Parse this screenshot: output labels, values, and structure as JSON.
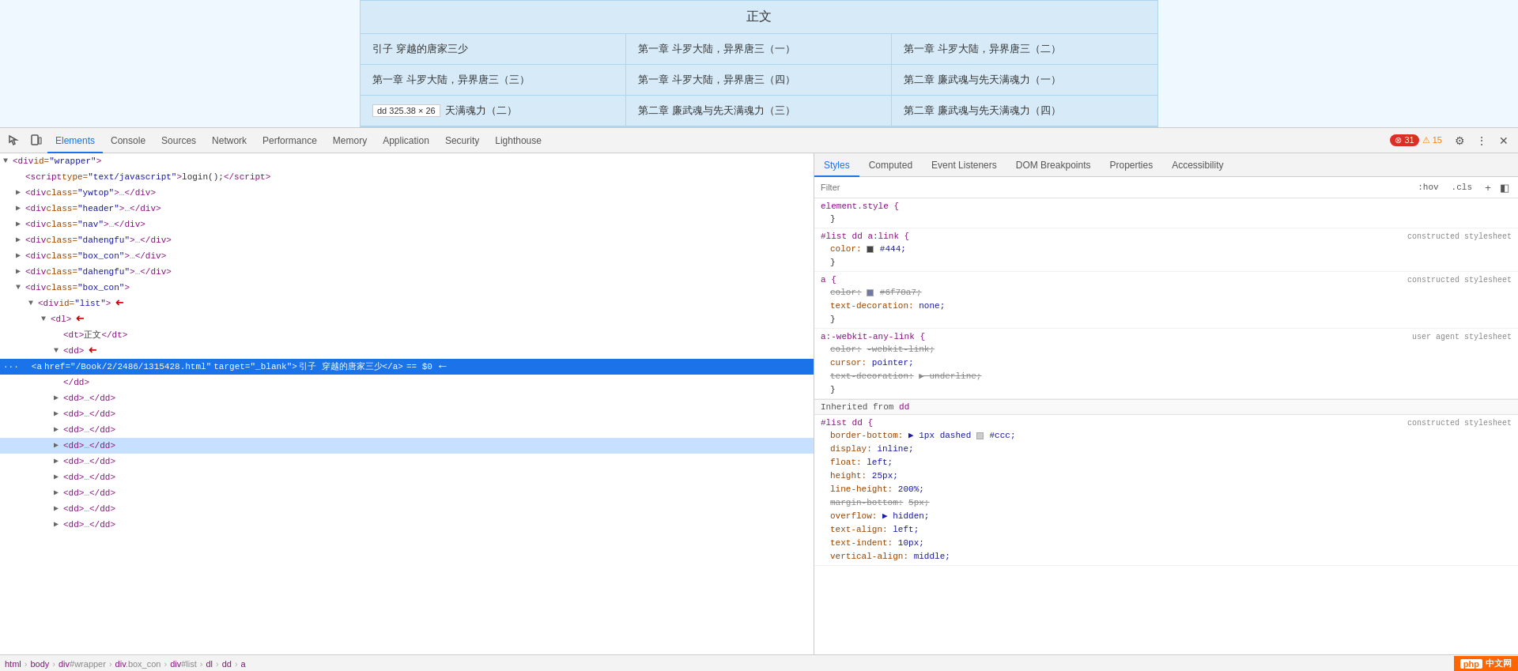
{
  "preview": {
    "title": "正文",
    "cells": [
      "引子 穿越的唐家三少",
      "第一章 斗罗大陆，异界唐三（一）",
      "第一章 斗罗大陆，异界唐三（二）",
      "第一章 斗罗大陆，异界唐三（三）",
      "第一章 斗罗大陆，异界唐三（四）",
      "第二章 廉武魂与先天满魂力（一）",
      "dd  325.38 × 26",
      "第二章 廉武魂与先天满魂力（三）",
      "第二章 廉武魂与先天满魂力（四）"
    ],
    "tooltip": "dd  325.38 × 26"
  },
  "devtools": {
    "tabs": [
      {
        "id": "elements",
        "label": "Elements",
        "active": true
      },
      {
        "id": "console",
        "label": "Console",
        "active": false
      },
      {
        "id": "sources",
        "label": "Sources",
        "active": false
      },
      {
        "id": "network",
        "label": "Network",
        "active": false
      },
      {
        "id": "performance",
        "label": "Performance",
        "active": false
      },
      {
        "id": "memory",
        "label": "Memory",
        "active": false
      },
      {
        "id": "application",
        "label": "Application",
        "active": false
      },
      {
        "id": "security",
        "label": "Security",
        "active": false
      },
      {
        "id": "lighthouse",
        "label": "Lighthouse",
        "active": false
      }
    ],
    "error_count": "31",
    "warn_count": "15"
  },
  "styles_tabs": [
    {
      "id": "styles",
      "label": "Styles",
      "active": true
    },
    {
      "id": "computed",
      "label": "Computed",
      "active": false
    },
    {
      "id": "event-listeners",
      "label": "Event Listeners",
      "active": false
    },
    {
      "id": "dom-breakpoints",
      "label": "DOM Breakpoints",
      "active": false
    },
    {
      "id": "properties",
      "label": "Properties",
      "active": false
    },
    {
      "id": "accessibility",
      "label": "Accessibility",
      "active": false
    }
  ],
  "filter": {
    "placeholder": "Filter",
    "hov_label": ":hov",
    "cls_label": ".cls"
  },
  "style_rules": [
    {
      "selector": "element.style {",
      "close": "}",
      "source": "",
      "properties": []
    },
    {
      "selector": "#list dd a:link {",
      "close": "}",
      "source": "constructed stylesheet",
      "properties": [
        {
          "name": "color:",
          "value": "#444",
          "swatch": "#444444",
          "strikethrough": false
        }
      ]
    },
    {
      "selector": "a {",
      "close": "}",
      "source": "constructed stylesheet",
      "properties": [
        {
          "name": "color:",
          "value": "#6f78a7",
          "swatch": "#6f78a7",
          "strikethrough": true
        },
        {
          "name": "text-decoration:",
          "value": "none",
          "swatch": null,
          "strikethrough": false
        }
      ]
    },
    {
      "selector": "a:-webkit-any-link {",
      "close": "}",
      "source": "user agent stylesheet",
      "properties": [
        {
          "name": "color:",
          "value": "-webkit-link",
          "swatch": null,
          "strikethrough": true
        },
        {
          "name": "cursor:",
          "value": "pointer",
          "swatch": null,
          "strikethrough": false
        },
        {
          "name": "text-decoration:",
          "value": "underline",
          "swatch": null,
          "strikethrough": true
        }
      ]
    }
  ],
  "inherited": {
    "label": "Inherited from",
    "tag": "dd",
    "selector": "#list dd {",
    "close": "}",
    "source": "constructed stylesheet",
    "properties": [
      {
        "name": "border-bottom:",
        "value": "▶ 1px dashed",
        "swatch": "#cccccc",
        "extra": "#ccc",
        "strikethrough": false
      },
      {
        "name": "display:",
        "value": "inline",
        "swatch": null,
        "strikethrough": false
      },
      {
        "name": "float:",
        "value": "left",
        "swatch": null,
        "strikethrough": false
      },
      {
        "name": "height:",
        "value": "25px",
        "swatch": null,
        "strikethrough": false
      },
      {
        "name": "line-height:",
        "value": "200%",
        "swatch": null,
        "strikethrough": false
      },
      {
        "name": "margin-bottom:",
        "value": "5px",
        "swatch": null,
        "strikethrough": true
      },
      {
        "name": "overflow:",
        "value": "▶ hidden",
        "swatch": null,
        "strikethrough": false
      },
      {
        "name": "text-align:",
        "value": "left",
        "swatch": null,
        "strikethrough": false
      },
      {
        "name": "text-indent:",
        "value": "10px",
        "swatch": null,
        "strikethrough": false
      },
      {
        "name": "vertical-align:",
        "value": "middle",
        "swatch": null,
        "strikethrough": false
      }
    ]
  },
  "elements": [
    {
      "indent": 0,
      "html": "▼<span class='tag'>&lt;div</span> <span class='attr-name'>id=</span><span class='attr-val'>\"wrapper\"</span><span class='tag'>&gt;</span>",
      "raw": "div_wrapper",
      "arrow": false
    },
    {
      "indent": 1,
      "html": "<span class='tag'>&lt;script</span> <span class='attr-name'>type=</span><span class='attr-val'>\"text/javascript\"</span><span class='tag'>&gt;</span><span class='text-content'>login();</span><span class='tag'>&lt;/script&gt;</span>",
      "raw": "script",
      "arrow": false
    },
    {
      "indent": 1,
      "html": "▶<span class='tag'>&lt;div</span> <span class='attr-name'>class=</span><span class='attr-val'>\"ywtop\"</span><span class='tag'>&gt;</span><span class='dots'>…</span><span class='tag'>&lt;/div&gt;</span>",
      "raw": "div_ywtop",
      "arrow": false
    },
    {
      "indent": 1,
      "html": "▶<span class='tag'>&lt;div</span> <span class='attr-name'>class=</span><span class='attr-val'>\"header\"</span><span class='tag'>&gt;</span><span class='dots'>…</span><span class='tag'>&lt;/div&gt;</span>",
      "raw": "div_header",
      "arrow": false
    },
    {
      "indent": 1,
      "html": "▶<span class='tag'>&lt;div</span> <span class='attr-name'>class=</span><span class='attr-val'>\"nav\"</span><span class='tag'>&gt;</span><span class='dots'>…</span><span class='tag'>&lt;/div&gt;</span>",
      "raw": "div_nav",
      "arrow": false
    },
    {
      "indent": 1,
      "html": "▶<span class='tag'>&lt;div</span> <span class='attr-name'>class=</span><span class='attr-val'>\"dahengfu\"</span><span class='tag'>&gt;</span><span class='dots'>…</span><span class='tag'>&lt;/div&gt;</span>",
      "raw": "div_dahengfu1",
      "arrow": false
    },
    {
      "indent": 1,
      "html": "▶<span class='tag'>&lt;div</span> <span class='attr-name'>class=</span><span class='attr-val'>\"box_con\"</span><span class='tag'>&gt;</span><span class='dots'>…</span><span class='tag'>&lt;/div&gt;</span>",
      "raw": "div_boxcon1",
      "arrow": false
    },
    {
      "indent": 1,
      "html": "▶<span class='tag'>&lt;div</span> <span class='attr-name'>class=</span><span class='attr-val'>\"dahengfu\"</span><span class='tag'>&gt;</span><span class='dots'>…</span><span class='tag'>&lt;/div&gt;</span>",
      "raw": "div_dahengfu2",
      "arrow": false
    },
    {
      "indent": 1,
      "html": "▼<span class='tag'>&lt;div</span> <span class='attr-name'>class=</span><span class='attr-val'>\"box_con\"</span><span class='tag'>&gt;</span>",
      "raw": "div_boxcon2",
      "arrow": false
    },
    {
      "indent": 2,
      "html": "▼<span class='tag'>&lt;div</span> <span class='attr-name'>id=</span><span class='attr-val'>\"list\"</span><span class='tag'>&gt;</span>",
      "raw": "div_list",
      "arrow": true
    },
    {
      "indent": 3,
      "html": "▼<span class='tag'>&lt;dl&gt;</span>",
      "raw": "dl",
      "arrow": true
    },
    {
      "indent": 4,
      "html": "<span class='tag'>&lt;dt&gt;</span><span class='text-content'>正文</span><span class='tag'>&lt;/dt&gt;</span>",
      "raw": "dt",
      "arrow": false
    },
    {
      "indent": 4,
      "html": "▼<span class='tag'>&lt;dd&gt;</span>",
      "raw": "dd_open",
      "arrow": true
    },
    {
      "indent": 5,
      "html": "<span class='tag'>&lt;a</span> <span class='attr-name'>href=</span><span class='attr-val'>\"/Book/2/2486/1315428.html\"</span> <span class='attr-name'>target=</span><span class='attr-val'>\"_blank\"</span><span class='tag'>&gt;</span><span class='text-content'>引子 穿越的唐家三少</span><span class='tag'>&lt;/a&gt;</span> == $0",
      "raw": "a_link",
      "arrow": false,
      "selected": true
    },
    {
      "indent": 4,
      "html": "<span class='tag'>&lt;/dd&gt;</span>",
      "raw": "dd_close",
      "arrow": false
    },
    {
      "indent": 4,
      "html": "▶<span class='tag'>&lt;dd&gt;</span><span class='dots'>…</span><span class='tag'>&lt;/dd&gt;</span>",
      "raw": "dd2",
      "arrow": false
    },
    {
      "indent": 4,
      "html": "▶<span class='tag'>&lt;dd&gt;</span><span class='dots'>…</span><span class='tag'>&lt;/dd&gt;</span>",
      "raw": "dd3",
      "arrow": false
    },
    {
      "indent": 4,
      "html": "▶<span class='tag'>&lt;dd&gt;</span><span class='dots'>…</span><span class='tag'>&lt;/dd&gt;</span>",
      "raw": "dd4",
      "arrow": false
    },
    {
      "indent": 4,
      "html": "▶<span class='tag'>&lt;dd&gt;</span><span class='dots'>…</span><span class='tag'>&lt;/dd&gt;</span>",
      "raw": "dd5",
      "arrow": false,
      "highlighted": true
    },
    {
      "indent": 4,
      "html": "▶<span class='tag'>&lt;dd&gt;</span><span class='dots'>…</span><span class='tag'>&lt;/dd&gt;</span>",
      "raw": "dd6",
      "arrow": false
    },
    {
      "indent": 4,
      "html": "▶<span class='tag'>&lt;dd&gt;</span><span class='dots'>…</span><span class='tag'>&lt;/dd&gt;</span>",
      "raw": "dd7",
      "arrow": false
    },
    {
      "indent": 4,
      "html": "▶<span class='tag'>&lt;dd&gt;</span><span class='dots'>…</span><span class='tag'>&lt;/dd&gt;</span>",
      "raw": "dd8",
      "arrow": false
    },
    {
      "indent": 4,
      "html": "▶<span class='tag'>&lt;dd&gt;</span><span class='dots'>…</span><span class='tag'>&lt;/dd&gt;</span>",
      "raw": "dd9",
      "arrow": false
    },
    {
      "indent": 4,
      "html": "▶<span class='tag'>&lt;dd&gt;</span><span class='dots'>…</span><span class='tag'>&lt;/dd&gt;</span>",
      "raw": "dd10",
      "arrow": false
    }
  ],
  "breadcrumb": [
    {
      "label": "html",
      "type": "tag"
    },
    {
      "label": "body",
      "type": "tag"
    },
    {
      "label": "div#wrapper",
      "type": "mixed"
    },
    {
      "label": "div.box_con",
      "type": "mixed"
    },
    {
      "label": "div#list",
      "type": "mixed"
    },
    {
      "label": "dl",
      "type": "tag"
    },
    {
      "label": "dd",
      "type": "tag"
    },
    {
      "label": "a",
      "type": "tag"
    }
  ],
  "php_logo": "php 中文网"
}
